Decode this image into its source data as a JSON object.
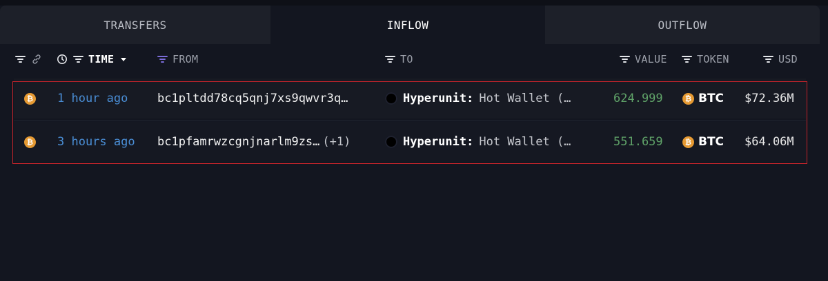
{
  "tabs": {
    "transfers": "TRANSFERS",
    "inflow": "INFLOW",
    "outflow": "OUTFLOW"
  },
  "columns": {
    "time": "TIME",
    "from": "FROM",
    "to": "TO",
    "value": "VALUE",
    "token": "TOKEN",
    "usd": "USD"
  },
  "colors": {
    "accent_time": "#4a8ed6",
    "value_green": "#5fa268",
    "highlight_border": "#c9242b",
    "btc_orange": "#e69a33"
  },
  "rows": [
    {
      "chain_icon": "bitcoin-icon",
      "time": "1 hour ago",
      "from": "bc1pltdd78cq5qnj7xs9qwvr3q…",
      "from_extra": "",
      "to_entity": "Hyperunit:",
      "to_label": "Hot Wallet (…",
      "value": "624.999",
      "token": "BTC",
      "usd": "$72.36M"
    },
    {
      "chain_icon": "bitcoin-icon",
      "time": "3 hours ago",
      "from": "bc1pfamrwzcgnjnarlm9zs…",
      "from_extra": "(+1)",
      "to_entity": "Hyperunit:",
      "to_label": "Hot Wallet (…",
      "value": "551.659",
      "token": "BTC",
      "usd": "$64.06M"
    }
  ]
}
